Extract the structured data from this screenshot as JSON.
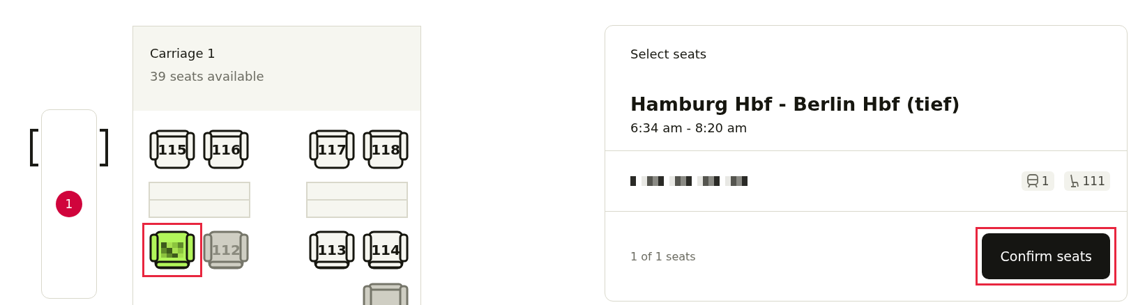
{
  "train_map": {
    "carriages": [
      {
        "badge": "1",
        "selected": true
      }
    ]
  },
  "carriage": {
    "title": "Carriage 1",
    "availability": "39 seats available",
    "rows": [
      {
        "kind": "forward",
        "left": [
          {
            "number": "115",
            "selected": false,
            "disabled": false,
            "highlighted": false
          },
          {
            "number": "116",
            "selected": false,
            "disabled": false,
            "highlighted": false
          }
        ],
        "right": [
          {
            "number": "117",
            "selected": false,
            "disabled": false,
            "highlighted": false
          },
          {
            "number": "118",
            "selected": false,
            "disabled": false,
            "highlighted": false
          }
        ]
      },
      {
        "kind": "tables"
      },
      {
        "kind": "backward",
        "left": [
          {
            "selected": true,
            "disabled": false,
            "highlighted": true
          },
          {
            "number": "112",
            "selected": false,
            "disabled": true,
            "highlighted": false
          }
        ],
        "right": [
          {
            "number": "113",
            "selected": false,
            "disabled": false,
            "highlighted": false
          },
          {
            "number": "114",
            "selected": false,
            "disabled": false,
            "highlighted": false
          }
        ]
      },
      {
        "kind": "forward",
        "left": [],
        "right": [
          {
            "selected": false,
            "disabled": true
          }
        ]
      }
    ]
  },
  "summary": {
    "heading": "Select seats",
    "route": "Hamburg Hbf - Berlin Hbf (tief)",
    "times": "6:34 am - 8:20 am",
    "passenger": {
      "carriage": "1",
      "seat": "111"
    },
    "count": "1 of 1 seats",
    "confirm": {
      "label": "Confirm seats",
      "highlighted": true
    }
  }
}
